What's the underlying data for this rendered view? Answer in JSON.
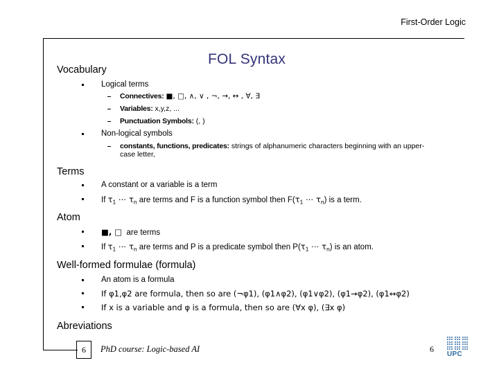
{
  "header": {
    "text": "First-Order Logic"
  },
  "title": "FOL Syntax",
  "sections": {
    "vocabulary": {
      "heading": "Vocabulary",
      "logical_terms": {
        "label": "Logical terms",
        "connectives": {
          "lead": "Connectives:",
          "value": "■, □, ∧, ∨ , ¬, →, ↔ , ∀, ∃"
        },
        "variables": {
          "lead": "Variables:",
          "value": "x,y,z, ..."
        },
        "punctuation": {
          "lead": "Punctuation Symbols:",
          "value": "(, )"
        }
      },
      "non_logical_symbols": {
        "label": "Non-logical symbols",
        "constants": {
          "lead": "constants, functions, predicates:",
          "value": "strings of alphanumeric characters beginning with an upper-case letter,"
        }
      }
    },
    "terms": {
      "heading": "Terms",
      "bullet1": "A constant or a variable is a term",
      "bullet2_pre": "If ",
      "bullet2_tau1": "τ",
      "bullet2_sub1": "1",
      "bullet2_dots": " ⋯ ",
      "bullet2_taun": "τ",
      "bullet2_subn": "n",
      "bullet2_mid": " are terms and F is a function symbol then F(",
      "bullet2_end": ") is a term."
    },
    "atom": {
      "heading": "Atom",
      "bullet1_symbols": "■, □",
      "bullet1_text": "are terms",
      "bullet2_mid": " are terms and P is a predicate symbol then P(",
      "bullet2_end": ") is an atom."
    },
    "wff": {
      "heading": "Well-formed formulae (formula)",
      "bullet1": "An atom is a formula",
      "bullet2": "If φ1,φ2 are formula, then so are (¬φ1), (φ1∧φ2), (φ1∨φ2), (φ1→φ2), (φ1↔φ2)",
      "bullet3": "If x is a variable and φ is a formula, then so are  (∀x φ), (∃x φ)"
    },
    "abreviations": {
      "heading": "Abreviations"
    }
  },
  "footer": {
    "page_box": "6",
    "course": "PhD course: Logic-based AI",
    "page_number": "6",
    "logo_text": "UPC"
  },
  "colors": {
    "title": "#333377",
    "logo": "#2f6ba3",
    "text": "#000000"
  }
}
